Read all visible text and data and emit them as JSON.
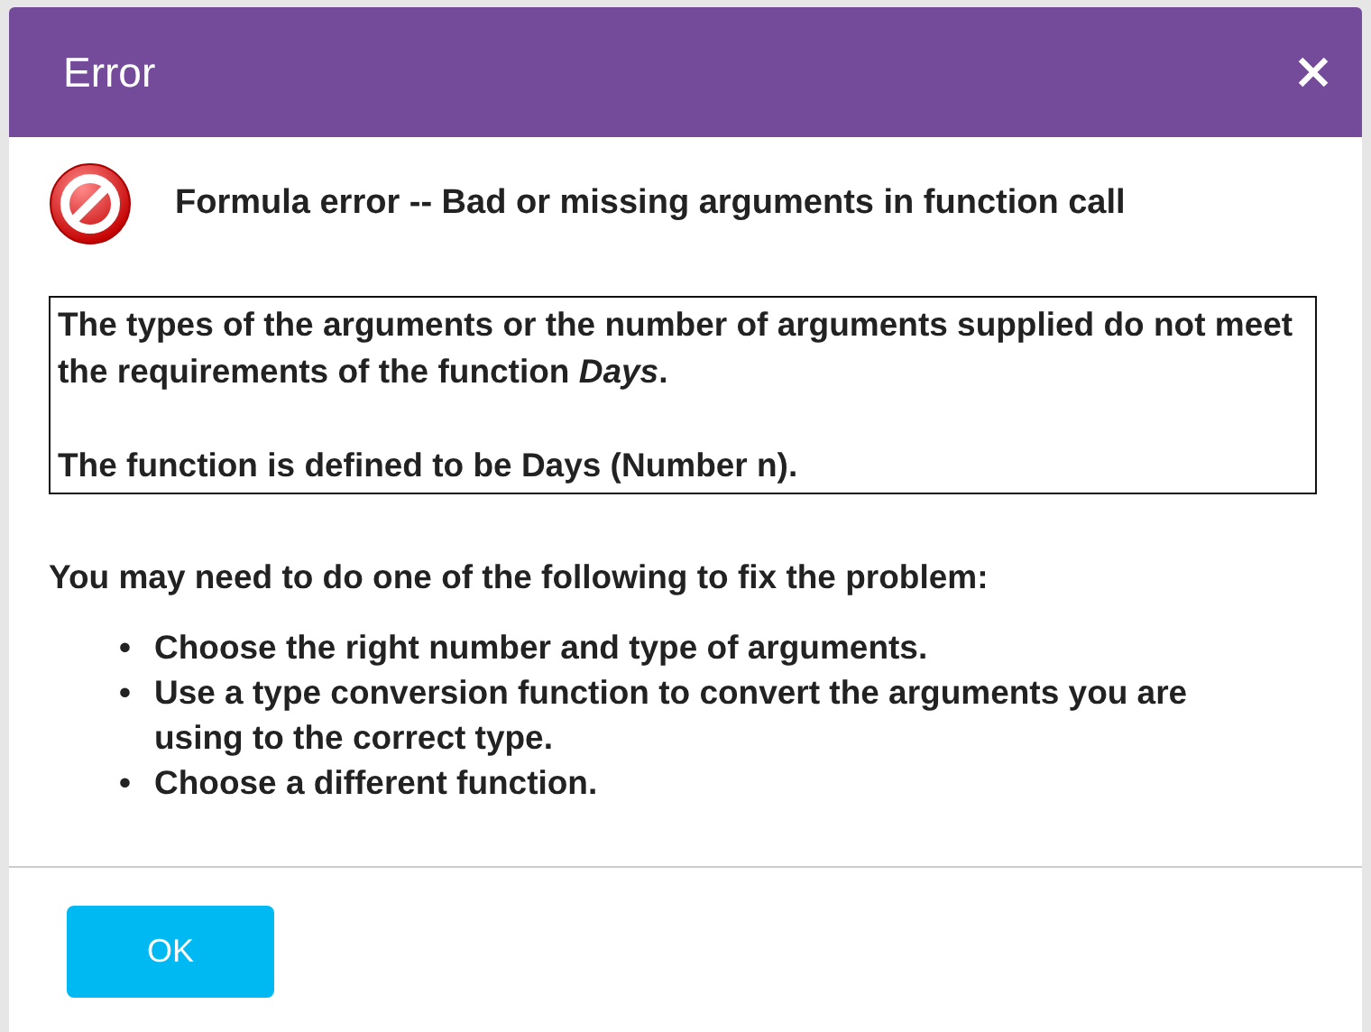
{
  "dialog": {
    "title": "Error"
  },
  "error": {
    "heading": "Formula error -- Bad or missing arguments in function call"
  },
  "details": [
    "The types of the arguments or the number of arguments supplied do not meet the requirements of the function *Days*.",
    "The function is defined to be Days (Number n)."
  ],
  "instructions": "You may need to do one of the following to fix the problem:",
  "suggestions": [
    {
      "bullet": "•",
      "text": "Choose the right number and type of arguments."
    },
    {
      "bullet": "•",
      "text": "Use a type conversion function to convert the arguments you are using to the correct type."
    },
    {
      "bullet": "•",
      "text": "Choose a different function."
    }
  ],
  "buttons": [
    "OK"
  ]
}
